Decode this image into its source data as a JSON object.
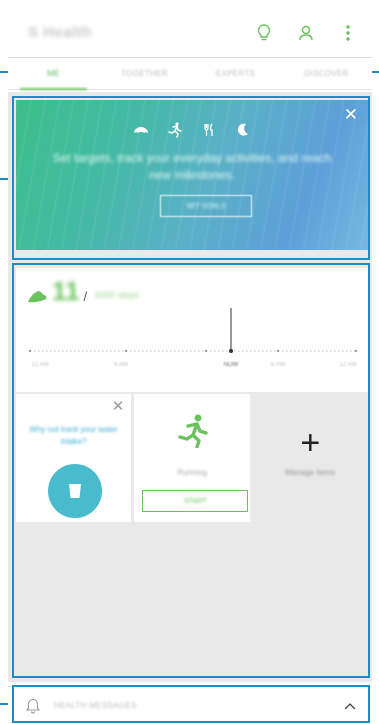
{
  "header": {
    "app_title": "S Health",
    "icons": [
      "lightbulb-icon",
      "people-icon",
      "more-icon"
    ]
  },
  "tabs": [
    {
      "label": "ME",
      "active": true
    },
    {
      "label": "TOGETHER",
      "active": false
    },
    {
      "label": "EXPERTS",
      "active": false
    },
    {
      "label": "DISCOVER",
      "active": false
    }
  ],
  "banner": {
    "icons": [
      "shoe-icon",
      "running-icon",
      "fork-knife-icon",
      "moon-icon"
    ],
    "text": "Set targets, track your everyday activities, and reach new milestones.",
    "button_label": "SET GOALS"
  },
  "steps": {
    "count": "11",
    "slash": "/",
    "goal": "6000 steps",
    "time_labels": [
      "12 AM",
      "6 AM",
      "NOW",
      "6 PM",
      "12 AM"
    ]
  },
  "water_card": {
    "text": "Why not track your water intake?"
  },
  "running_card": {
    "label": "Running",
    "button_label": "START"
  },
  "add_card": {
    "plus": "+",
    "label": "Manage items"
  },
  "messages": {
    "label": "HEALTH MESSAGES"
  },
  "colors": {
    "accent_green": "#6cc25e",
    "water_blue": "#48bccd",
    "callout_blue": "#1f8dc4"
  }
}
